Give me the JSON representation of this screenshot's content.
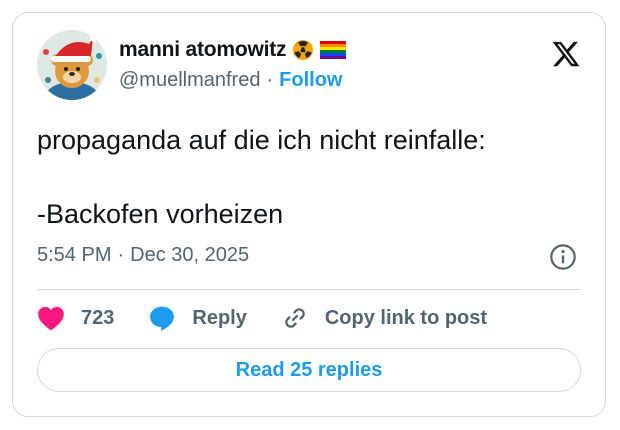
{
  "author": {
    "display_name": "manni atomowitz",
    "handle": "@muellmanfred",
    "follow_label": "Follow",
    "avatar_description": "cartoon bear in a Santa hat",
    "emojis": [
      "radioactive-emoji",
      "rainbow-flag-emoji"
    ]
  },
  "tweet": {
    "text_line_1": "propaganda auf die ich nicht reinfalle:",
    "text_line_2": "-Backofen vorheizen",
    "time": "5:54 PM",
    "date": "Dec 30, 2025"
  },
  "actions": {
    "likes": "723",
    "reply_label": "Reply",
    "copy_link_label": "Copy link to post"
  },
  "footer": {
    "read_replies_label": "Read 25 replies"
  },
  "colors": {
    "accent": "#1d9bf0",
    "like": "#f91880",
    "text": "#0f1419",
    "secondary": "#536471",
    "border": "#cfd9de"
  }
}
